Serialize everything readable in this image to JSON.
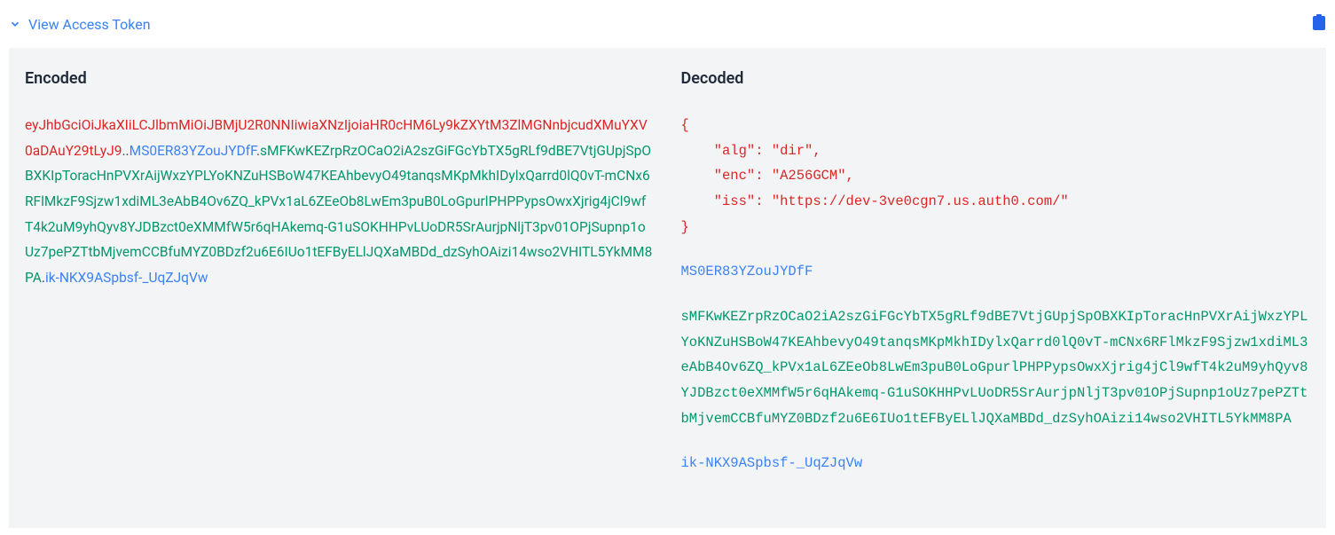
{
  "header": {
    "title": "View Access Token"
  },
  "encoded": {
    "title": "Encoded",
    "part1": "eyJhbGciOiJkaXIiLCJlbmMiOiJBMjU2R0NNIiwiaXNzIjoiaHR0cHM6Ly9kZXYtM3ZlMGNnbjcudXMuYXV0aDAuY29tLyJ9",
    "part2": "MS0ER83YZouJYDfF",
    "part3": "sMFKwKEZrpRzOCaO2iA2szGiFGcYbTX5gRLf9dBE7VtjGUpjSpOBXKIpToracHnPVXrAijWxzYPLYoKNZuHSBoW47KEAhbevyO49tanqsMKpMkhIDylxQarrd0lQ0vT-mCNx6RFlMkzF9Sjzw1xdiML3eAbB4Ov6ZQ_kPVx1aL6ZEeOb8LwEm3puB0LoGpurlPHPPypsOwxXjrig4jCl9wfT4k2uM9yhQyv8YJDBzct0eXMMfW5r6qHAkemq-G1uSOKHHPvLUoDR5SrAurjpNljT3pv01OPjSupnp1oUz7pePZTtbMjvemCCBfuMYZ0BDzf2u6E6IUo1tEFByELlJQXaMBDd_dzSyhOAizi14wso2VHITL5YkMM8PA",
    "part4": "ik-NKX9ASpbsf-_UqZJqVw"
  },
  "decoded": {
    "title": "Decoded",
    "json_text": "{\n    \"alg\": \"dir\",\n    \"enc\": \"A256GCM\",\n    \"iss\": \"https://dev-3ve0cgn7.us.auth0.com/\"\n}",
    "part2": "MS0ER83YZouJYDfF",
    "part3": "sMFKwKEZrpRzOCaO2iA2szGiFGcYbTX5gRLf9dBE7VtjGUpjSpOBXKIpToracHnPVXrAijWxzYPLYoKNZuHSBoW47KEAhbevyO49tanqsMKpMkhIDylxQarrd0lQ0vT-mCNx6RFlMkzF9Sjzw1xdiML3eAbB4Ov6ZQ_kPVx1aL6ZEeOb8LwEm3puB0LoGpurlPHPPypsOwxXjrig4jCl9wfT4k2uM9yhQyv8YJDBzct0eXMMfW5r6qHAkemq-G1uSOKHHPvLUoDR5SrAurjpNljT3pv01OPjSupnp1oUz7pePZTtbMjvemCCBfuMYZ0BDzf2u6E6IUo1tEFByELlJQXaMBDd_dzSyhOAizi14wso2VHITL5YkMM8PA",
    "part4": "ik-NKX9ASpbsf-_UqZJqVw"
  }
}
